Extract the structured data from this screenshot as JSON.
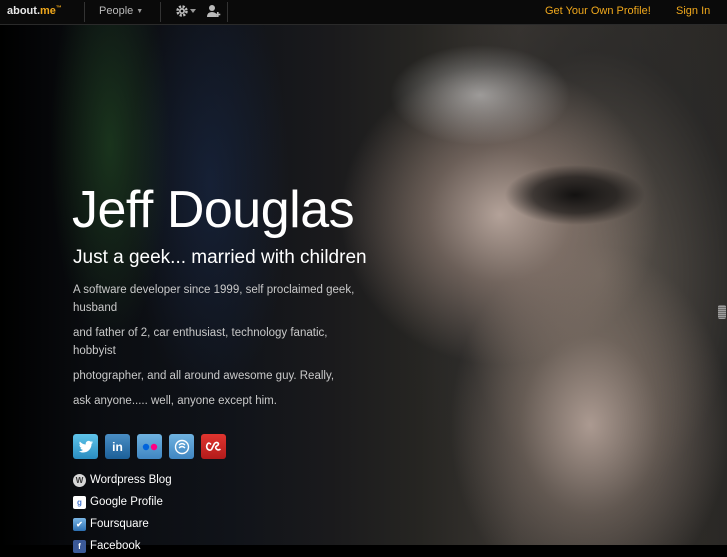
{
  "topbar": {
    "logo_text": "about.",
    "logo_accent": "me",
    "logo_tm": "™",
    "people_label": "People",
    "get_profile_link": "Get Your Own Profile!",
    "sign_in_link": "Sign In"
  },
  "profile": {
    "name": "Jeff Douglas",
    "tagline": "Just a geek... married with children",
    "bio": [
      "A software developer since 1999, self proclaimed geek, husband",
      "and father of 2, car enthusiast, technology fanatic, hobbyist",
      "photographer, and all around awesome guy.  Really,",
      "ask anyone..... well, anyone except him."
    ]
  },
  "social_icons": [
    {
      "name": "twitter-icon"
    },
    {
      "name": "linkedin-icon"
    },
    {
      "name": "flickr-icon"
    },
    {
      "name": "rss-icon"
    },
    {
      "name": "lastfm-icon"
    }
  ],
  "links": [
    {
      "label": "Wordpress Blog",
      "icon": "wordpress-icon"
    },
    {
      "label": "Google Profile",
      "icon": "google-icon"
    },
    {
      "label": "Foursquare",
      "icon": "foursquare-icon"
    },
    {
      "label": "Facebook",
      "icon": "facebook-icon"
    }
  ],
  "colors": {
    "accent": "#f0a81c",
    "background": "#000000"
  }
}
